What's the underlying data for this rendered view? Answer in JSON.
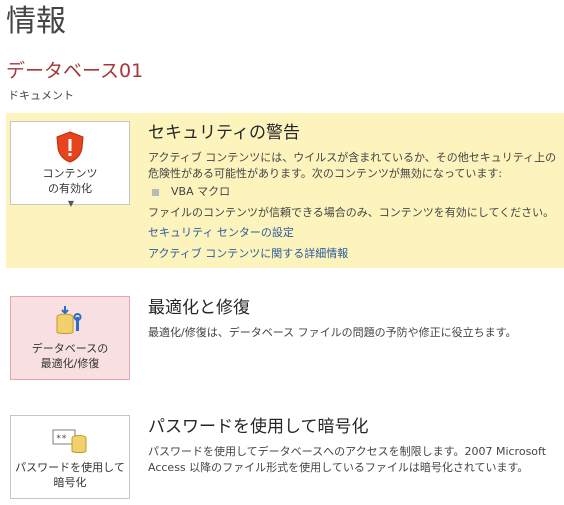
{
  "page": {
    "title": "情報"
  },
  "database": {
    "name": "データベース01",
    "path": "ドキュメント"
  },
  "security": {
    "button_line1": "コンテンツ",
    "button_line2": "の有効化",
    "title": "セキュリティの警告",
    "description": "アクティブ コンテンツには、ウイルスが含まれているか、その他セキュリティ上の危険性がある可能性があります。次のコンテンツが無効になっています:",
    "disabled_items": [
      "VBA マクロ"
    ],
    "trust_note": "ファイルのコンテンツが信頼できる場合のみ、コンテンツを有効にしてください。",
    "link_settings": "セキュリティ センターの設定",
    "link_details": "アクティブ コンテンツに関する詳細情報",
    "accent_color": "#fcf3bd"
  },
  "optimize": {
    "button_line1": "データベースの",
    "button_line2": "最適化/修復",
    "title": "最適化と修復",
    "description": "最適化/修復は、データベース ファイルの問題の予防や修正に役立ちます。"
  },
  "encrypt": {
    "button_line1": "パスワードを使用して",
    "button_line2": "暗号化",
    "title": "パスワードを使用して暗号化",
    "description": "パスワードを使用してデータベースへのアクセスを制限します。2007 Microsoft Access 以降のファイル形式を使用しているファイルは暗号化されています。"
  },
  "icons": {
    "security": "shield-warning-icon",
    "optimize": "database-tools-icon",
    "encrypt": "password-database-icon"
  }
}
